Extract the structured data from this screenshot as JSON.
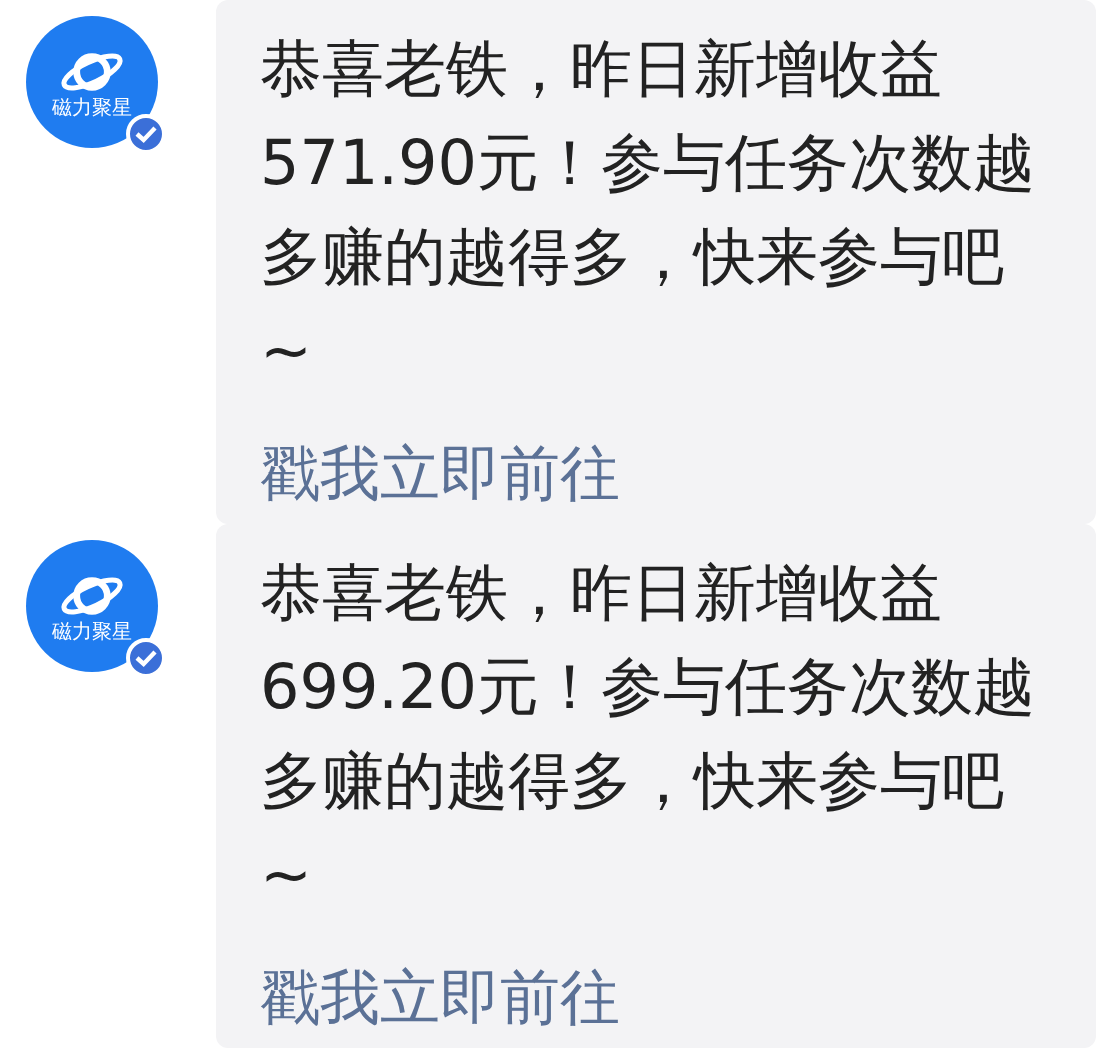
{
  "messages": [
    {
      "avatar": {
        "label": "磁力聚星",
        "verified": true
      },
      "text": "恭喜老铁，昨日新增收益571.90元！参与任务次数越多赚的越得多，快来参与吧~",
      "link": "戳我立即前往"
    },
    {
      "avatar": {
        "label": "磁力聚星",
        "verified": true
      },
      "text": "恭喜老铁，昨日新增收益699.20元！参与任务次数越多赚的越得多，快来参与吧~",
      "link": "戳我立即前往"
    }
  ]
}
